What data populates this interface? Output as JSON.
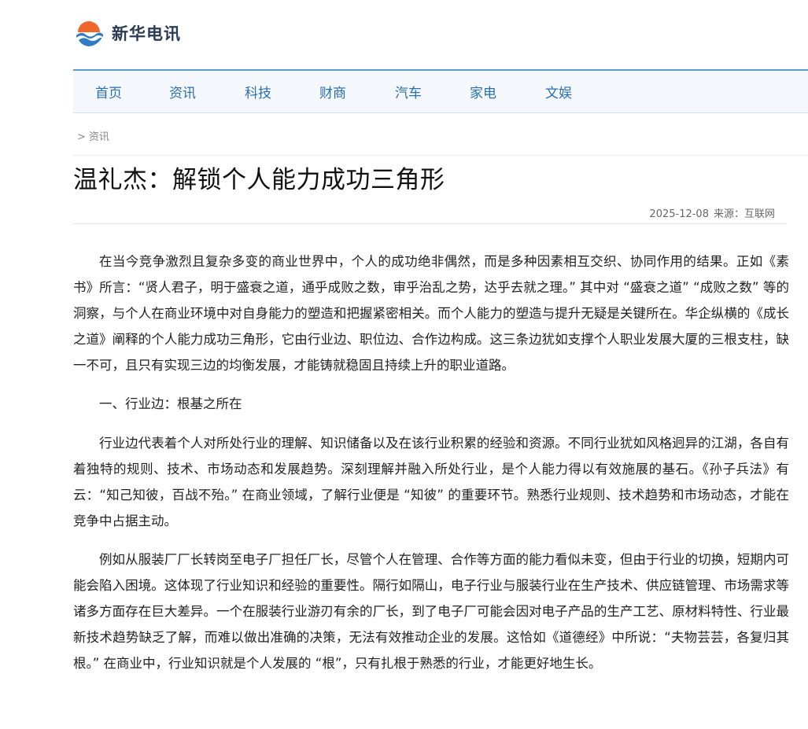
{
  "site": {
    "logo_name": "新华电讯",
    "colors": {
      "logo_orange": "#f0672e",
      "logo_blue": "#2f7dc0",
      "nav_text": "#2a6fb0",
      "nav_border": "#5a9fd0",
      "nav_bg": "#f4f8fc"
    }
  },
  "nav": {
    "items": [
      {
        "label": "首页"
      },
      {
        "label": "资讯"
      },
      {
        "label": "科技"
      },
      {
        "label": "财商"
      },
      {
        "label": "汽车"
      },
      {
        "label": "家电"
      },
      {
        "label": "文娱"
      }
    ]
  },
  "breadcrumb": {
    "separator": ">",
    "current": "资讯"
  },
  "article": {
    "title": "温礼杰：解锁个人能力成功三角形",
    "date": "2025-12-08",
    "source": "来源：互联网",
    "paragraphs": [
      "在当今竞争激烈且复杂多变的商业世界中，个人的成功绝非偶然，而是多种因素相互交织、协同作用的结果。正如《素书》所言：“贤人君子，明于盛衰之道，通乎成败之数，审乎治乱之势，达乎去就之理。” 其中对 “盛衰之道” “成败之数” 等的洞察，与个人在商业环境中对自身能力的塑造和把握紧密相关。而个人能力的塑造与提升无疑是关键所在。华企纵横的《成长之道》阐释的个人能力成功三角形，它由行业边、职位边、合作边构成。这三条边犹如支撑个人职业发展大厦的三根支柱，缺一不可，且只有实现三边的均衡发展，才能铸就稳固且持续上升的职业道路。",
      "一、行业边：根基之所在",
      "行业边代表着个人对所处行业的理解、知识储备以及在该行业积累的经验和资源。不同行业犹如风格迥异的江湖，各自有着独特的规则、技术、市场动态和发展趋势。深刻理解并融入所处行业，是个人能力得以有效施展的基石。《孙子兵法》有云：“知己知彼，百战不殆。” 在商业领域，了解行业便是 “知彼” 的重要环节。熟悉行业规则、技术趋势和市场动态，才能在竞争中占据主动。",
      "例如从服装厂厂长转岗至电子厂担任厂长，尽管个人在管理、合作等方面的能力看似未变，但由于行业的切换，短期内可能会陷入困境。这体现了行业知识和经验的重要性。隔行如隔山，电子行业与服装行业在生产技术、供应链管理、市场需求等诸多方面存在巨大差异。一个在服装行业游刃有余的厂长，到了电子厂可能会因对电子产品的生产工艺、原材料特性、行业最新技术趋势缺乏了解，而难以做出准确的决策，无法有效推动企业的发展。这恰如《道德经》中所说：“夫物芸芸，各复归其根。” 在商业中，行业知识就是个人发展的 “根”，只有扎根于熟悉的行业，才能更好地生长。"
    ]
  }
}
